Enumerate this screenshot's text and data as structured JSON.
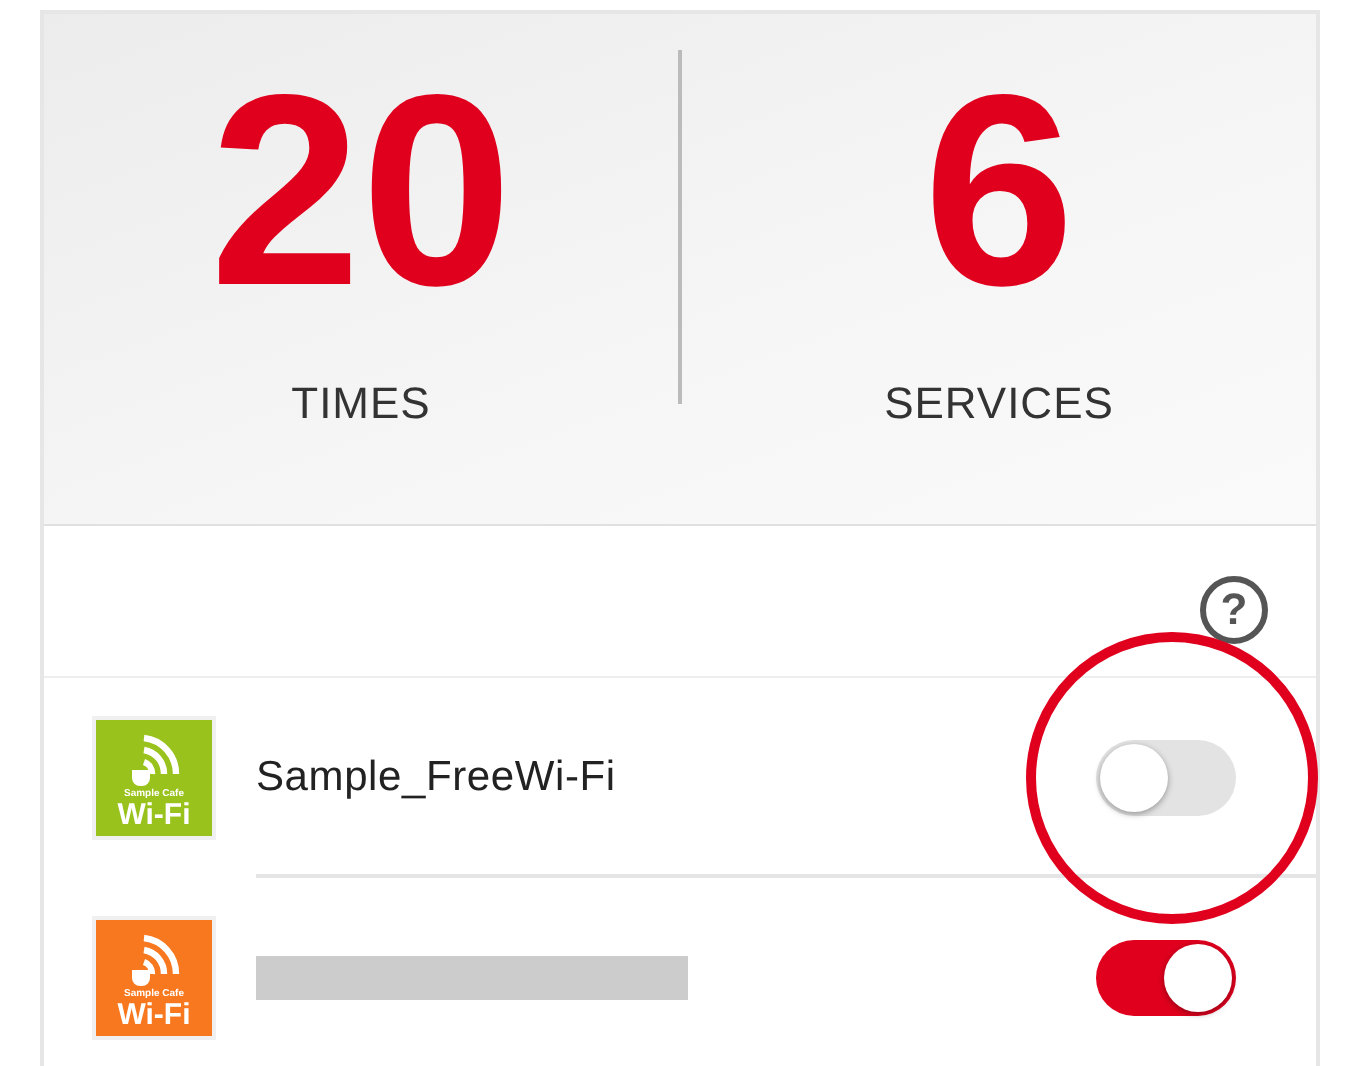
{
  "stats": [
    {
      "value": "20",
      "label": "TIMES"
    },
    {
      "value": "6",
      "label": "SERVICES"
    }
  ],
  "help": {
    "icon_text": "?"
  },
  "networks": [
    {
      "kind": "named",
      "name": "Sample_FreeWi-Fi",
      "color": "#99c21c",
      "logo_caption": "Sample Cafe",
      "logo_title": "Wi-Fi",
      "on": false,
      "highlighted": true
    },
    {
      "kind": "redacted",
      "color": "#f7781e",
      "logo_caption": "Sample Cafe",
      "logo_title": "Wi-Fi",
      "on": true,
      "highlighted": false
    }
  ]
}
